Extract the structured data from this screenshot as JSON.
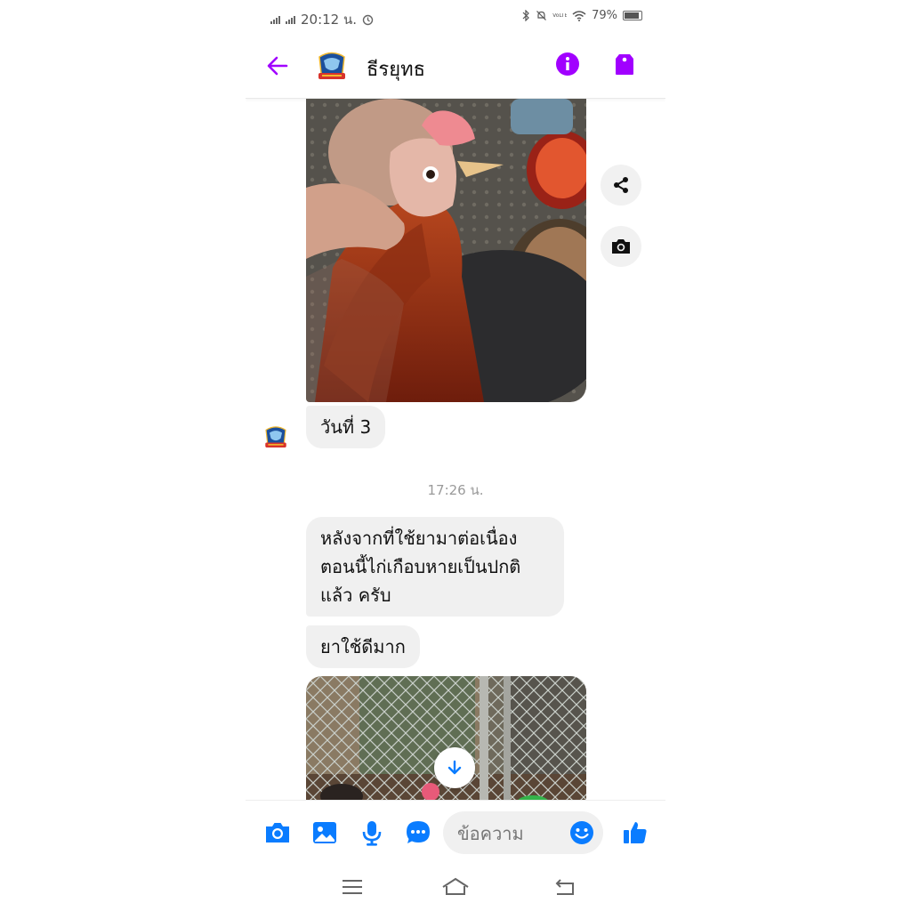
{
  "status_bar": {
    "time": "20:12 น.",
    "battery": "79%",
    "volte": "VoLTE"
  },
  "header": {
    "contact_name": "ธีรยุทธ",
    "avatar_icon": "team-logo-avatar",
    "accent_color": "#a100ff"
  },
  "chat": {
    "messages": [
      {
        "type": "image",
        "icon": "rooster-photo"
      },
      {
        "type": "text",
        "text": "วันที่ 3"
      },
      {
        "type": "timestamp",
        "text": "17:26 น."
      },
      {
        "type": "text",
        "text": "หลังจากที่ใช้ยามาต่อเนื่อง ตอนนี้ไก่เกือบหายเป็นปกติ แล้ว ครับ"
      },
      {
        "type": "text",
        "text": "ยาใช้ดีมาก"
      },
      {
        "type": "image",
        "icon": "chicken-coop-photo"
      }
    ]
  },
  "composer": {
    "placeholder": "ข้อความ",
    "accent_color": "#0a7cff"
  }
}
